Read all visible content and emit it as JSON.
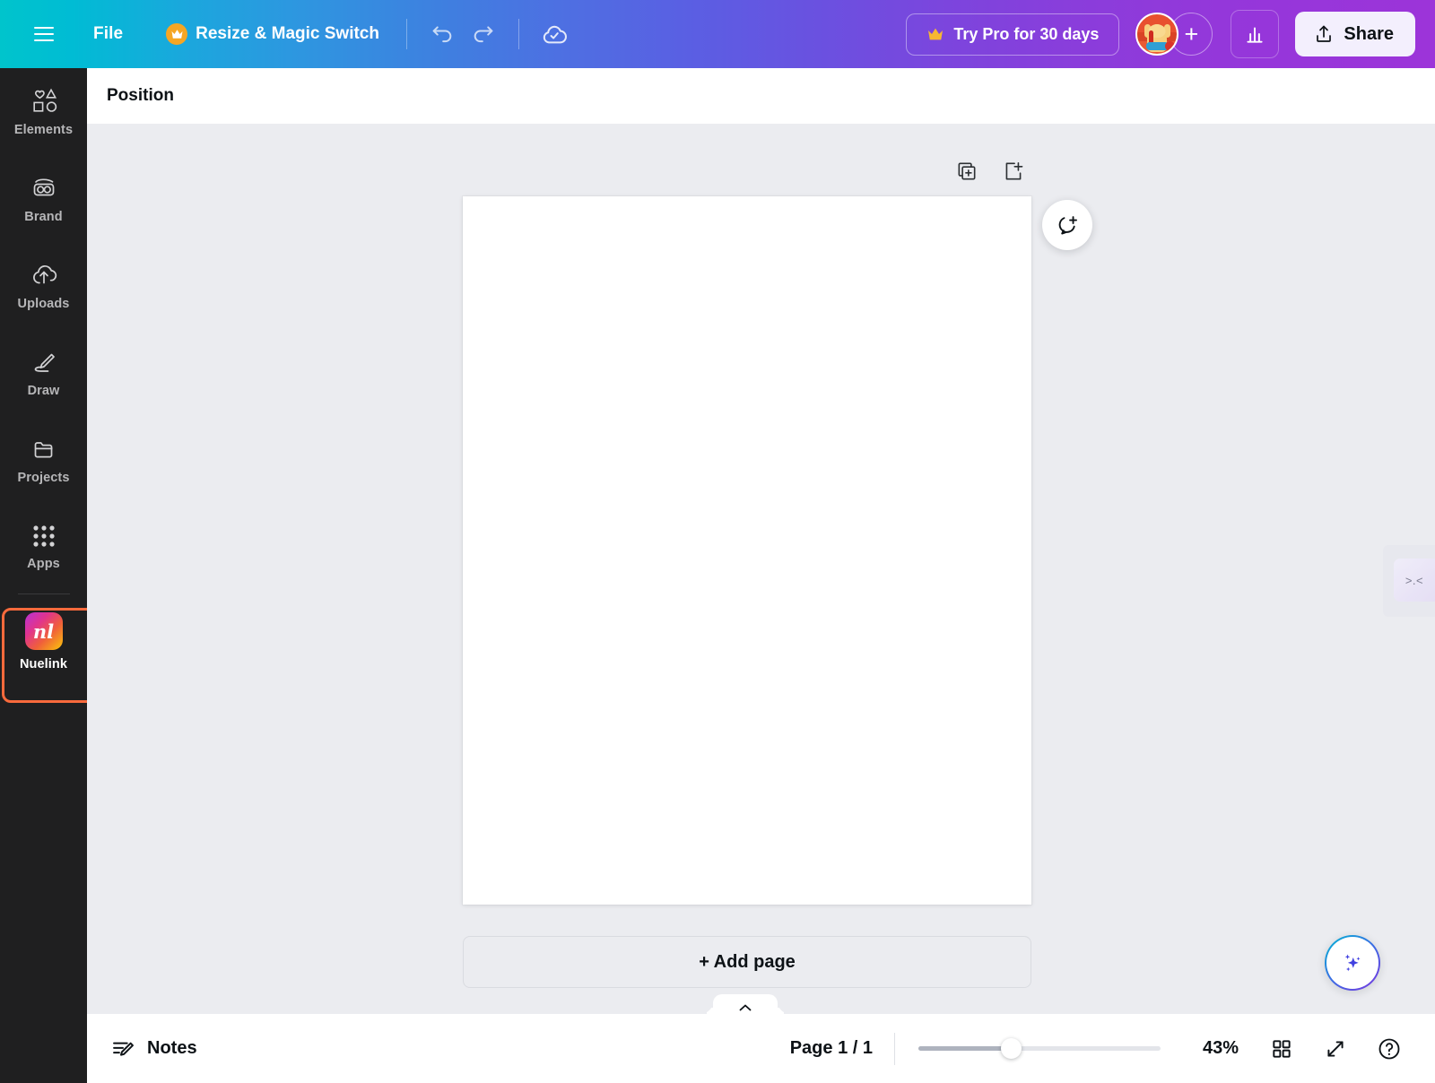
{
  "topbar": {
    "menu_icon": "hamburger-icon",
    "file_label": "File",
    "resize_label": "Resize & Magic Switch",
    "crown_icon": "crown-icon",
    "undo_icon": "undo-icon",
    "redo_icon": "redo-icon",
    "cloud_saved_icon": "cloud-check-icon",
    "try_pro_label": "Try Pro for 30 days",
    "avatar_name": "user-avatar",
    "add_collaborator_label": "+",
    "stats_icon": "bar-chart-icon",
    "share_label": "Share",
    "share_icon": "upload-icon",
    "gradient_start": "#00c4cc",
    "gradient_end": "#9c34d9"
  },
  "sidebar": {
    "items": [
      {
        "label": "Elements",
        "icon": "shapes-icon"
      },
      {
        "label": "Brand",
        "icon": "brand-icon"
      },
      {
        "label": "Uploads",
        "icon": "upload-cloud-icon"
      },
      {
        "label": "Draw",
        "icon": "pen-icon"
      },
      {
        "label": "Projects",
        "icon": "folder-icon"
      },
      {
        "label": "Apps",
        "icon": "grid-dots-icon"
      }
    ],
    "active_app": {
      "label": "Nuelink",
      "icon": "nuelink-logo-icon",
      "logo_text": "nl",
      "highlight_color": "#f96a3c"
    }
  },
  "panel": {
    "title": "Position"
  },
  "canvas": {
    "duplicate_page_icon": "duplicate-page-icon",
    "add_page_icon": "add-page-icon",
    "comment_icon": "add-comment-icon",
    "add_page_label": "+ Add page",
    "collapse_icon": "chevron-up-icon",
    "magic_icon": "magic-sparkles-icon",
    "side_widget_label": ">.<",
    "background_color": "#ebecf0"
  },
  "bottombar": {
    "notes_label": "Notes",
    "notes_icon": "notes-pencil-icon",
    "page_count": "Page 1 / 1",
    "zoom_level": "43%",
    "grid_view_icon": "grid-view-icon",
    "fullscreen_icon": "expand-arrows-icon",
    "help_icon": "help-circle-icon"
  }
}
